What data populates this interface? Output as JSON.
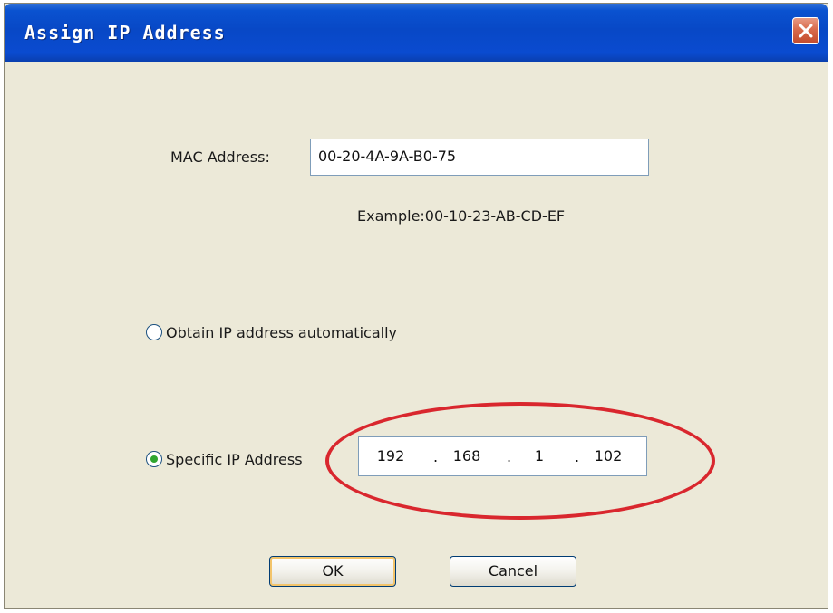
{
  "window": {
    "title": "Assign IP Address"
  },
  "mac": {
    "label": "MAC Address:",
    "value": "00-20-4A-9A-B0-75",
    "example": "Example:00-10-23-AB-CD-EF"
  },
  "options": {
    "auto_label": "Obtain IP address automatically",
    "auto_selected": false,
    "specific_label": "Specific IP Address",
    "specific_selected": true
  },
  "ip": {
    "octets": [
      "192",
      "168",
      "1",
      "102"
    ],
    "separator": "."
  },
  "buttons": {
    "ok_label": "OK",
    "cancel_label": "Cancel"
  },
  "colors": {
    "titlebar": "#0848c6",
    "dialog_background": "#ece9d8",
    "highlight_ring": "#d9272e",
    "radio_selected": "#2fa52f"
  },
  "icons": {
    "close": "close-icon"
  }
}
